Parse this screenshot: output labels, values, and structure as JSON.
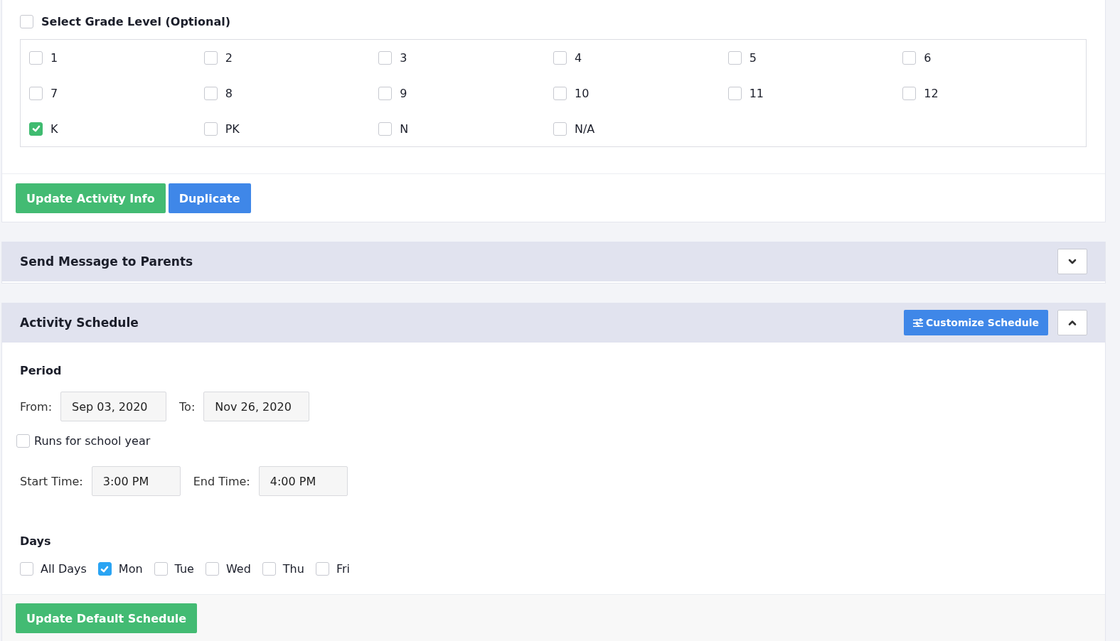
{
  "grade_section": {
    "label": "Select Grade Level (Optional)",
    "checked": false,
    "grades": [
      {
        "label": "1",
        "checked": false
      },
      {
        "label": "2",
        "checked": false
      },
      {
        "label": "3",
        "checked": false
      },
      {
        "label": "4",
        "checked": false
      },
      {
        "label": "5",
        "checked": false
      },
      {
        "label": "6",
        "checked": false
      },
      {
        "label": "7",
        "checked": false
      },
      {
        "label": "8",
        "checked": false
      },
      {
        "label": "9",
        "checked": false
      },
      {
        "label": "10",
        "checked": false
      },
      {
        "label": "11",
        "checked": false
      },
      {
        "label": "12",
        "checked": false
      },
      {
        "label": "K",
        "checked": true
      },
      {
        "label": "PK",
        "checked": false
      },
      {
        "label": "N",
        "checked": false
      },
      {
        "label": "N/A",
        "checked": false
      }
    ],
    "buttons": [
      {
        "label": "Update Activity Info",
        "kind": "success"
      },
      {
        "label": "Duplicate",
        "kind": "primary"
      }
    ]
  },
  "message_panel": {
    "title": "Send Message to Parents",
    "expanded": false
  },
  "schedule_panel": {
    "title": "Activity Schedule",
    "expanded": true,
    "customize_button": "Customize Schedule",
    "period_heading": "Period",
    "from_label": "From:",
    "from_value": "Sep 03, 2020",
    "to_label": "To:",
    "to_value": "Nov 26, 2020",
    "school_year": {
      "label": "Runs for school year",
      "checked": false
    },
    "start_label": "Start Time:",
    "start_value": "3:00 PM",
    "end_label": "End Time:",
    "end_value": "4:00 PM",
    "days_heading": "Days",
    "days": [
      {
        "label": "All Days",
        "checked": false
      },
      {
        "label": "Mon",
        "checked": true
      },
      {
        "label": "Tue",
        "checked": false
      },
      {
        "label": "Wed",
        "checked": false
      },
      {
        "label": "Thu",
        "checked": false
      },
      {
        "label": "Fri",
        "checked": false
      }
    ],
    "submit_button": "Update Default Schedule"
  }
}
